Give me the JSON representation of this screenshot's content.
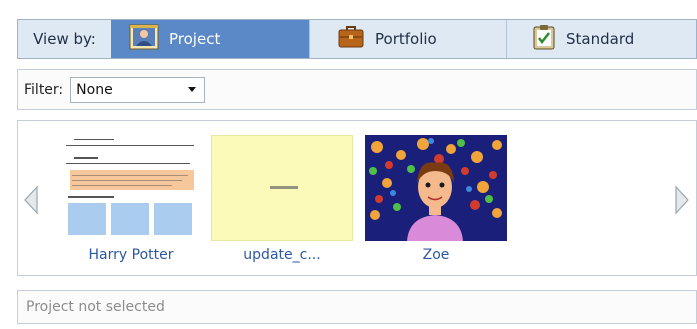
{
  "view_by": {
    "label": "View by:",
    "tabs": [
      {
        "label": "Project",
        "icon": "student-portrait-icon",
        "active": true
      },
      {
        "label": "Portfolio",
        "icon": "briefcase-icon",
        "active": false
      },
      {
        "label": "Standard",
        "icon": "clipboard-check-icon",
        "active": false
      }
    ]
  },
  "filter": {
    "label": "Filter:",
    "selected": "None"
  },
  "gallery": {
    "items": [
      {
        "caption": "Harry Potter",
        "thumbnail": "document-thumbnail"
      },
      {
        "caption": "update_c...",
        "thumbnail": "yellow-page-thumbnail"
      },
      {
        "caption": "Zoe",
        "thumbnail": "drawing-thumbnail"
      }
    ],
    "prev_icon": "left-arrow-icon",
    "next_icon": "right-arrow-icon"
  },
  "status": {
    "text": "Project not selected"
  },
  "colors": {
    "active_tab": "#5b89c7",
    "tab_bar": "#dfe9f4",
    "caption_link": "#2c58a0",
    "status_text": "#8c8c8c"
  }
}
